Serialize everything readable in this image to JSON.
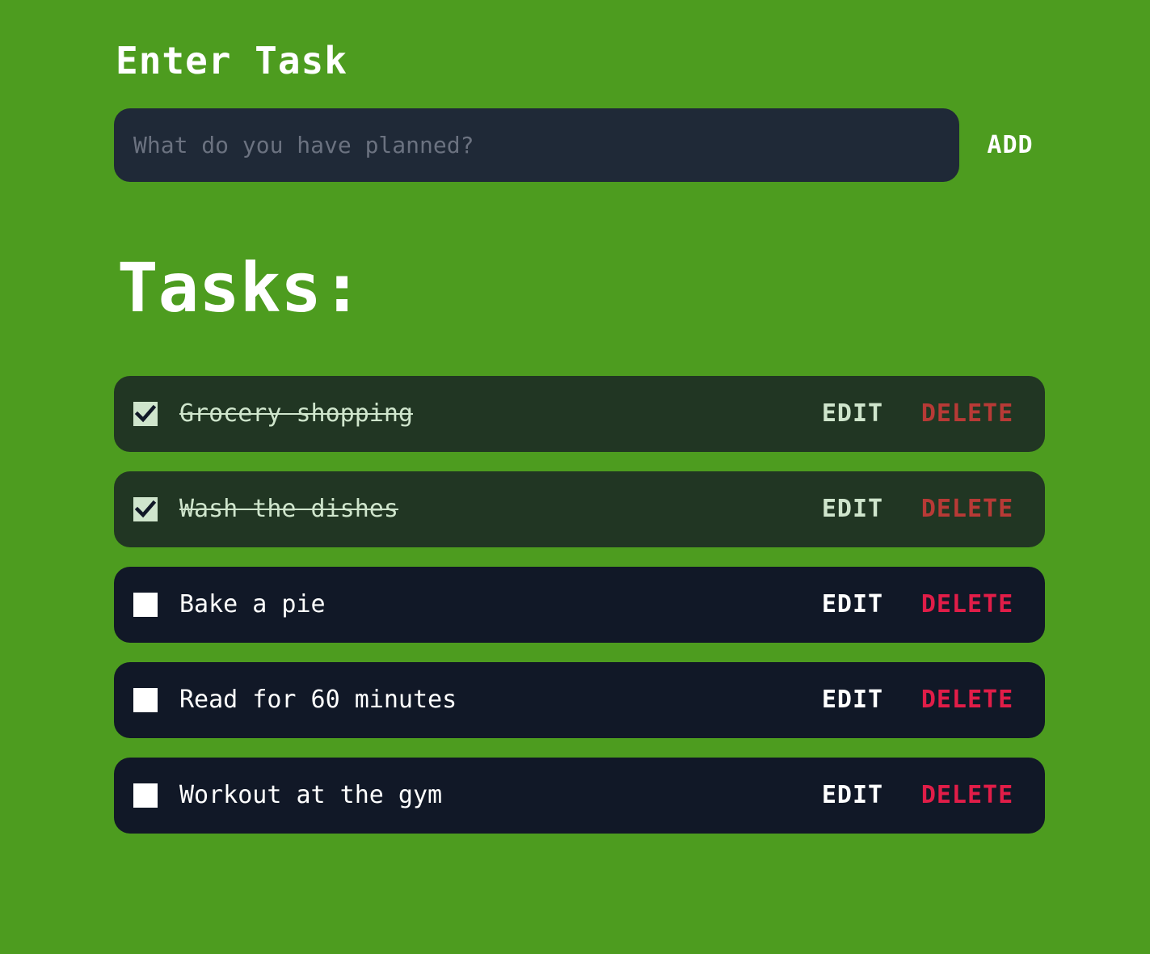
{
  "header": {
    "title": "Enter Task"
  },
  "input": {
    "placeholder": "What do you have planned?",
    "value": "",
    "add_label": "ADD"
  },
  "list": {
    "title": "Tasks:",
    "edit_label": "EDIT",
    "delete_label": "DELETE",
    "tasks": [
      {
        "text": "Grocery shopping",
        "done": true
      },
      {
        "text": "Wash the dishes",
        "done": true
      },
      {
        "text": "Bake a pie",
        "done": false
      },
      {
        "text": "Read for 60 minutes",
        "done": false
      },
      {
        "text": "Workout at the gym",
        "done": false
      }
    ]
  },
  "colors": {
    "background": "#4d9c1f",
    "input_bg": "#1f2937",
    "task_bg": "#111827",
    "task_done_bg": "#213623",
    "delete": "#e11d48",
    "delete_done": "#b83a36",
    "done_text": "#cfe5cc"
  },
  "icons": {
    "checked": "check-icon"
  }
}
